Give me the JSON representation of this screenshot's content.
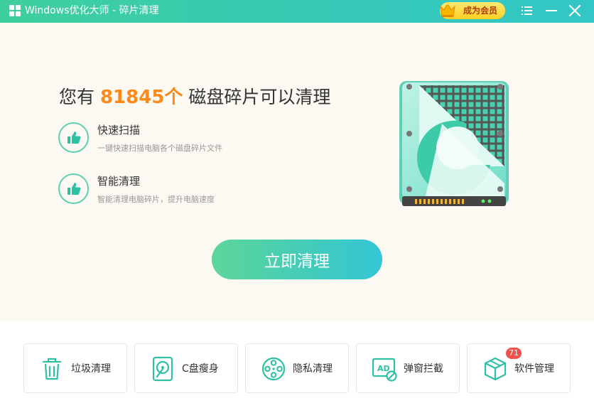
{
  "window": {
    "title": "Windows优化大师 - 碎片清理",
    "vip_label": "成为会员",
    "icons": {
      "logo": "windows-logo-icon",
      "menu": "menu-icon",
      "minimize": "minimize-icon",
      "close": "close-icon",
      "crown": "crown-icon"
    }
  },
  "main": {
    "headline": {
      "prefix": "您有 ",
      "count": "81845个",
      "suffix": " 磁盘碎片可以清理"
    },
    "features": [
      {
        "title": "快速扫描",
        "desc": "一键快速扫描电脑各个磁盘碎片文件",
        "icon": "thumbs-up-icon"
      },
      {
        "title": "智能清理",
        "desc": "智能清理电脑碎片，提升电脑速度",
        "icon": "thumbs-up-icon"
      }
    ],
    "illustration": "hard-disk-icon",
    "clean_button": "立即清理"
  },
  "tools": [
    {
      "label": "垃圾清理",
      "icon": "trash-icon"
    },
    {
      "label": "C盘瘦身",
      "icon": "disk-slim-icon"
    },
    {
      "label": "隐私清理",
      "icon": "film-reel-icon"
    },
    {
      "label": "弹窗拦截",
      "icon": "ad-block-icon"
    },
    {
      "label": "软件管理",
      "icon": "package-box-icon",
      "badge": "71"
    }
  ],
  "colors": {
    "accent": "#3fcf9e",
    "highlight": "#fb8a1a",
    "panel_bg": "#fcf9f2",
    "badge_red": "#f2504b"
  }
}
